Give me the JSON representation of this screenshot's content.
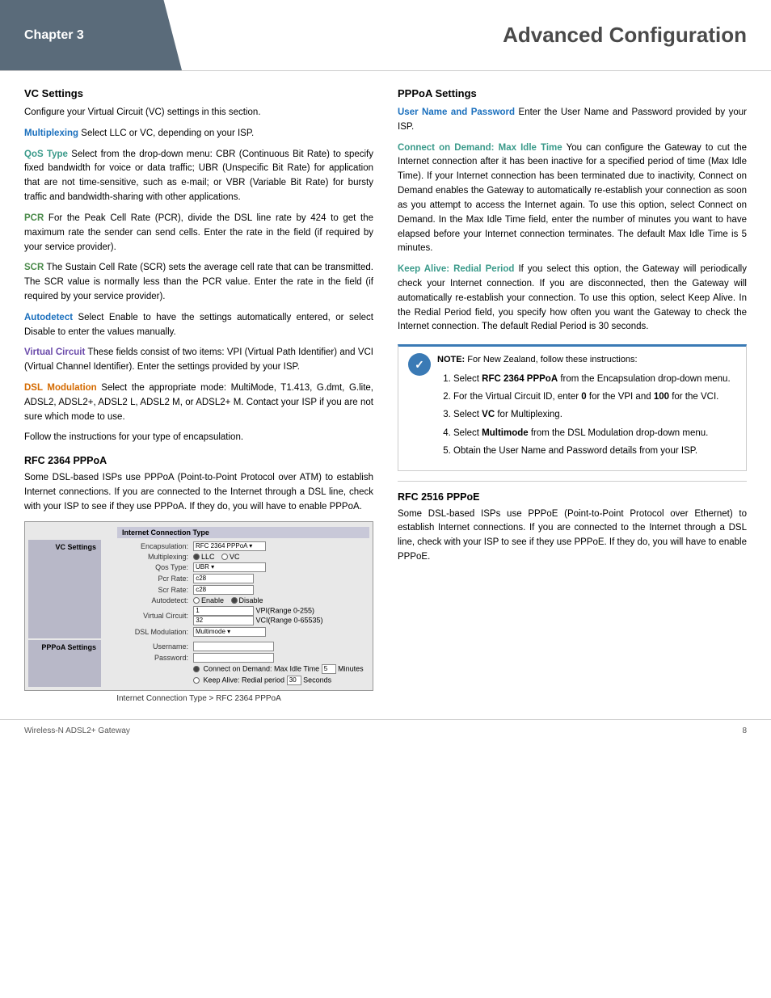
{
  "header": {
    "chapter_label": "Chapter 3",
    "title": "Advanced Configuration"
  },
  "footer": {
    "left": "Wireless-N ADSL2+ Gateway",
    "right": "8"
  },
  "left_column": {
    "vc_settings_heading": "VC Settings",
    "vc_settings_intro": "Configure your Virtual Circuit (VC) settings in this section.",
    "multiplexing_term": "Multiplexing",
    "multiplexing_text": "  Select LLC or VC, depending on your ISP.",
    "qos_term": "QoS Type",
    "qos_text": " Select from the drop-down menu: CBR (Continuous Bit Rate) to specify fixed bandwidth for voice or data traffic; UBR (Unspecific Bit Rate) for application that are not time-sensitive, such as e-mail; or VBR (Variable Bit Rate) for bursty traffic and bandwidth-sharing with other applications.",
    "pcr_term": "PCR",
    "pcr_text": "  For the Peak Cell Rate (PCR), divide the DSL line rate by 424 to get the maximum rate the sender can send cells. Enter the rate in the field (if required by your service provider).",
    "scr_term": "SCR",
    "scr_text": "  The Sustain Cell Rate (SCR) sets the average cell rate that can be transmitted. The SCR value is normally less than the PCR value. Enter the rate in the field (if required by your service provider).",
    "autodetect_term": "Autodetect",
    "autodetect_text": " Select Enable to have the settings automatically entered, or select Disable to enter the values manually.",
    "virtual_circuit_term": "Virtual Circuit",
    "virtual_circuit_text": " These fields consist of two items: VPI (Virtual Path Identifier) and VCI (Virtual Channel Identifier). Enter the settings provided by your ISP.",
    "dsl_modulation_term": "DSL   Modulation",
    "dsl_modulation_text": " Select the appropriate mode: MultiMode, T1.413, G.dmt, G.lite, ADSL2, ADSL2+, ADSL2 L, ADSL2 M, or ADSL2+ M. Contact your ISP if you are not sure which mode to use.",
    "follow_instructions": "Follow the instructions for your type of encapsulation.",
    "rfc2364_heading": "RFC 2364 PPPoA",
    "rfc2364_intro": "Some DSL-based ISPs use PPPoA (Point-to-Point Protocol over ATM) to establish Internet connections. If you are connected to the Internet through a DSL line, check with your ISP to see if they use PPPoA. If they do, you will have to enable PPPoA.",
    "screenshot_caption": "Internet Connection Type > RFC 2364 PPPoA",
    "screenshot": {
      "rows": [
        {
          "section": "Internet Connection Type"
        },
        {
          "label": "VC Settings",
          "is_section": true
        },
        {
          "label": "Encapsulation:",
          "value": "RFC 2364 PPPoA",
          "type": "select"
        },
        {
          "label": "Multiplexing:",
          "value": "",
          "type": "radio",
          "options": [
            "LLC",
            "VC"
          ],
          "selected": "LLC"
        },
        {
          "label": "Qos Type:",
          "value": "UBR",
          "type": "select"
        },
        {
          "label": "Pcr Rate:",
          "value": "c28",
          "type": "input"
        },
        {
          "label": "Scr Rate:",
          "value": "c28",
          "type": "input"
        },
        {
          "label": "Autodetect:",
          "value": "",
          "type": "radio_disable",
          "options": [
            "Enable",
            "Disable"
          ],
          "selected": "Disable"
        },
        {
          "label": "Virtual Circuit:",
          "value": "1   VPI(Range 0-255)\n32  VCI(Range 0-65535)",
          "type": "vci"
        },
        {
          "label": "DSL Modulation:",
          "value": "Multimode",
          "type": "select"
        },
        {
          "section": "PPPoA Settings"
        },
        {
          "label": "Username:",
          "value": "",
          "type": "input"
        },
        {
          "label": "Password:",
          "value": "",
          "type": "input"
        },
        {
          "label": "",
          "value": "Connect on Demand: Max Idle Time 5 Minutes",
          "type": "radio_option"
        },
        {
          "label": "",
          "value": "Keep Alive: Redial period 30  Seconds",
          "type": "radio_option"
        }
      ]
    }
  },
  "right_column": {
    "pppoa_heading": "PPPoA Settings",
    "user_name_term": "User Name and Password",
    "user_name_text": " Enter the User Name and Password provided by your ISP.",
    "connect_demand_term": "Connect on Demand: Max Idle Time",
    "connect_demand_text": "  You can configure the Gateway to cut the Internet connection after it has been inactive for a specified period of time (Max Idle Time). If your Internet connection has been terminated due to inactivity, Connect on Demand enables the Gateway to automatically re-establish your connection as soon as you attempt to access the Internet again. To use this option, select Connect on Demand. In the Max Idle Time field, enter the number of minutes you want to have elapsed before your Internet connection terminates. The default Max Idle Time is 5 minutes.",
    "keep_alive_term": "Keep Alive: Redial Period",
    "keep_alive_text": " If you select this option, the Gateway will periodically check your Internet connection. If you are disconnected, then the Gateway will automatically re-establish your connection. To use this option, select Keep Alive. In the Redial Period field, you specify how often you want the Gateway to check the Internet connection. The default Redial Period is 30 seconds.",
    "note_label": "NOTE:",
    "note_text": " For New Zealand, follow these instructions:",
    "numbered_list": [
      "Select RFC 2364 PPPoA from the Encapsulation drop-down menu.",
      "For the Virtual Circuit ID, enter 0 for the VPI and 100 for the VCI.",
      "Select VC for Multiplexing.",
      "Select Multimode from the DSL Modulation drop-down menu.",
      "Obtain the User Name and Password details from your ISP."
    ],
    "rfc2516_heading": "RFC 2516 PPPoE",
    "rfc2516_text": "Some DSL-based ISPs use PPPoE (Point-to-Point Protocol over Ethernet) to establish Internet connections. If you are connected to the Internet through a DSL line, check with your ISP to see if they use PPPoE. If they do, you will have to enable PPPoE."
  }
}
